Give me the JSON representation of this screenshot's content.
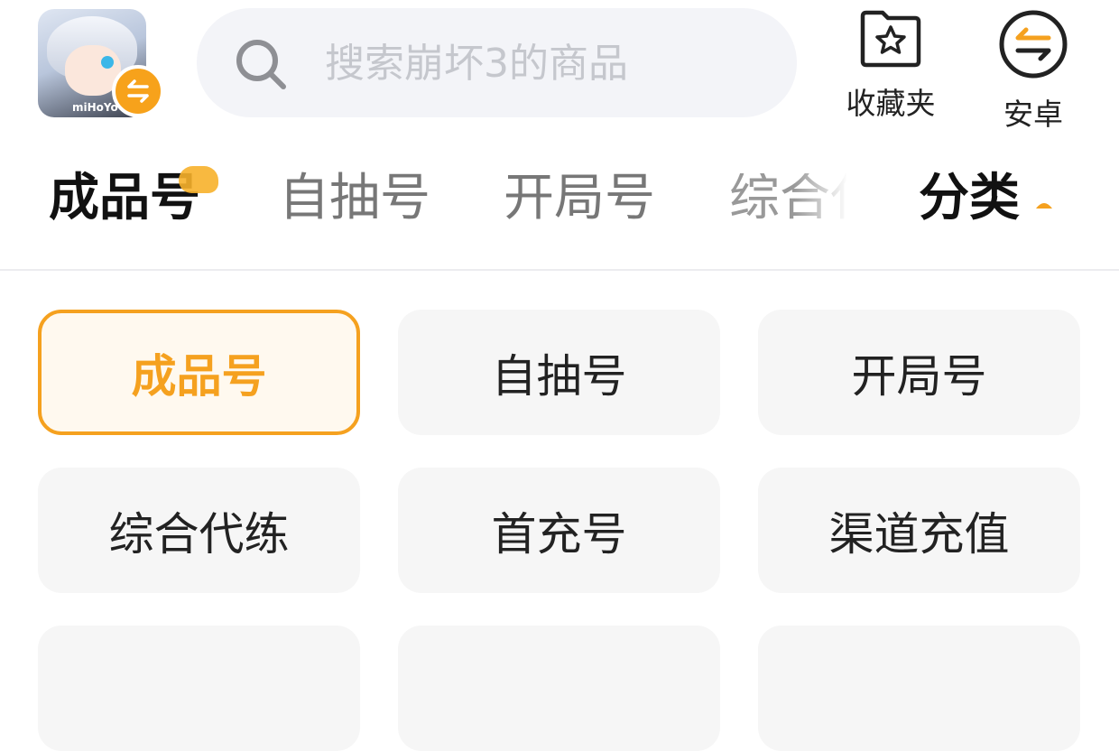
{
  "header": {
    "game_logo_text": "miHoYo",
    "search": {
      "placeholder": "搜索崩坏3的商品",
      "value": ""
    },
    "favorites_label": "收藏夹",
    "platform_label": "安卓",
    "accent_color": "#f5a11f"
  },
  "tabs": {
    "items": [
      {
        "label": "成品号",
        "active": true
      },
      {
        "label": "自抽号",
        "active": false
      },
      {
        "label": "开局号",
        "active": false
      },
      {
        "label": "综合代练",
        "active": false
      }
    ],
    "category_toggle_label": "分类",
    "category_panel_open": true
  },
  "categories": {
    "selected": "成品号",
    "items": [
      {
        "label": "成品号",
        "selected": true
      },
      {
        "label": "自抽号",
        "selected": false
      },
      {
        "label": "开局号",
        "selected": false
      },
      {
        "label": "综合代练",
        "selected": false
      },
      {
        "label": "首充号",
        "selected": false
      },
      {
        "label": "渠道充值",
        "selected": false
      }
    ]
  },
  "icons": {
    "search": "search-icon",
    "favorites": "star-folder-icon",
    "platform_switch": "switch-arrows-icon",
    "category_toggle": "caret-up-icon"
  }
}
